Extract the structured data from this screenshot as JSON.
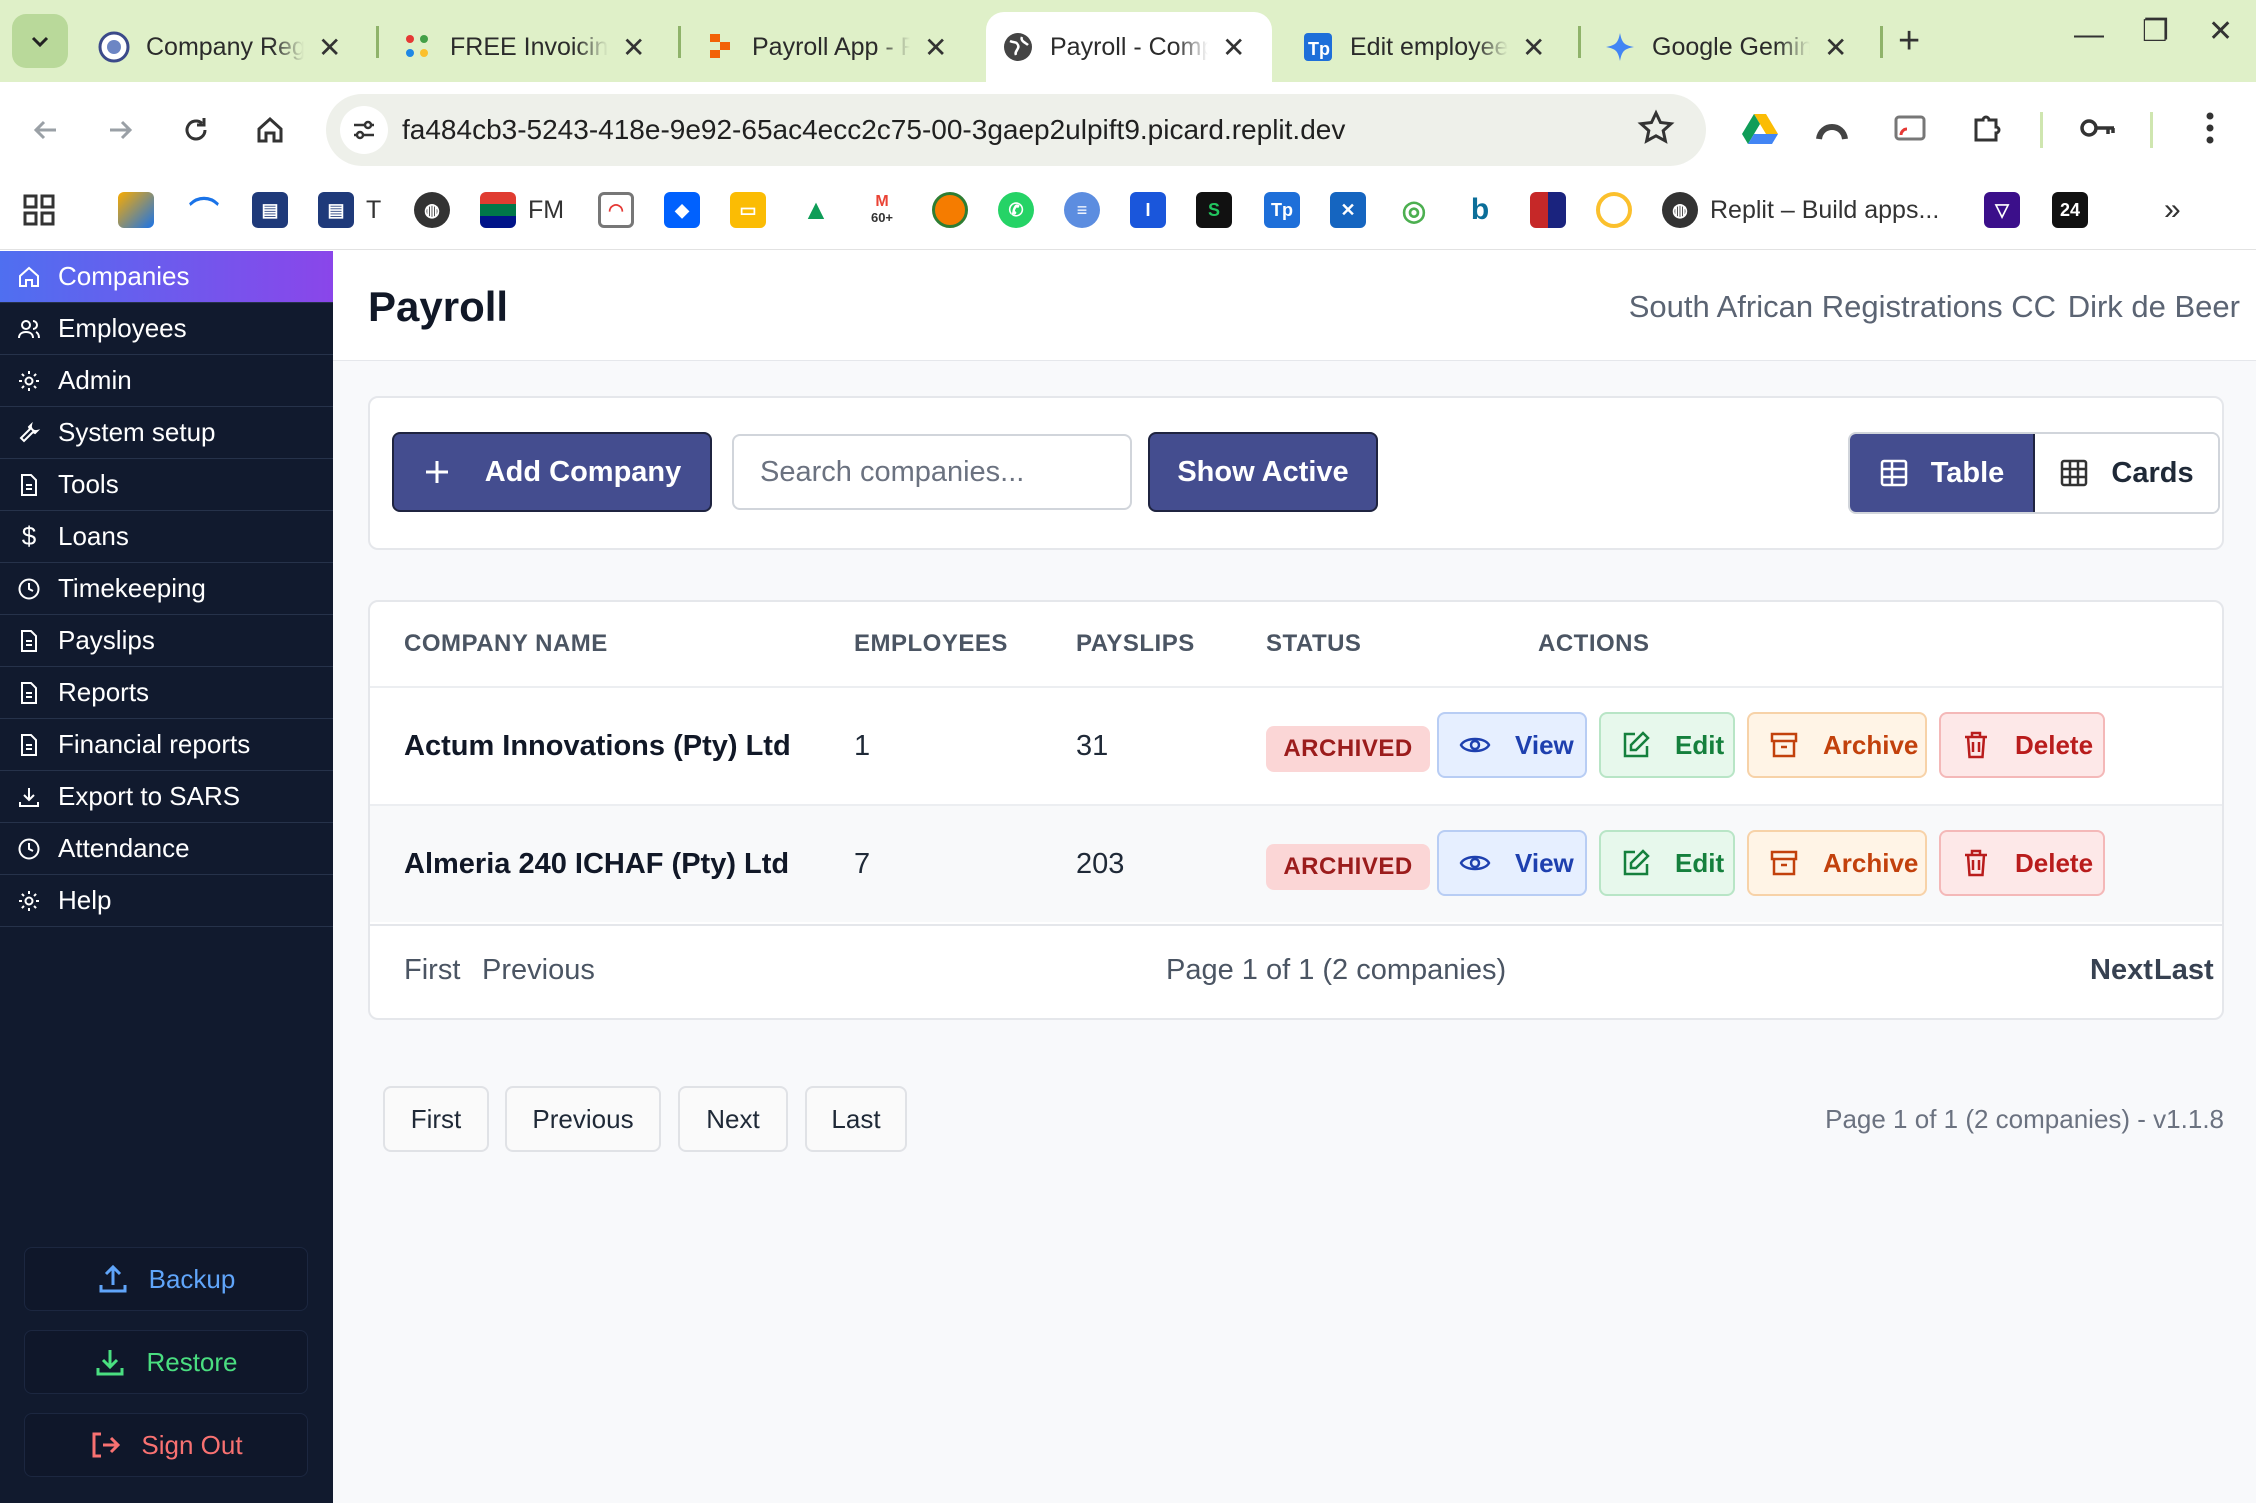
{
  "browser": {
    "tabs": [
      {
        "title": "Company Registrations",
        "icon": "globe-seal-icon"
      },
      {
        "title": "FREE Invoicing",
        "icon": "invoice-dots-icon"
      },
      {
        "title": "Payroll App - Replit",
        "icon": "replit-icon"
      },
      {
        "title": "Payroll - Companies",
        "icon": "globe-icon",
        "active": true
      },
      {
        "title": "Edit employee",
        "icon": "tp-icon"
      },
      {
        "title": "Google Gemini",
        "icon": "gemini-icon"
      }
    ],
    "url": "fa484cb3-5243-418e-9e92-65ac4ecc2c75-00-3gaep2ulpift9.picard.replit.dev",
    "bookmarks": [
      {
        "label": "T",
        "icon": "doc-icon"
      },
      {
        "label": "FM",
        "icon": "flag-icon"
      },
      {
        "label": "60+",
        "icon": "gmail-icon"
      },
      {
        "label": "Replit – Build apps...",
        "icon": "globe-icon"
      },
      {
        "label": "24",
        "icon": "calendar-icon"
      }
    ]
  },
  "sidebar": {
    "items": [
      {
        "label": "Companies",
        "icon": "home-icon",
        "active": true
      },
      {
        "label": "Employees",
        "icon": "users-icon"
      },
      {
        "label": "Admin",
        "icon": "gear-icon"
      },
      {
        "label": "System setup",
        "icon": "wrench-icon"
      },
      {
        "label": "Tools",
        "icon": "document-icon"
      },
      {
        "label": "Loans",
        "icon": "dollar-icon"
      },
      {
        "label": "Timekeeping",
        "icon": "clock-icon"
      },
      {
        "label": "Payslips",
        "icon": "document-icon"
      },
      {
        "label": "Reports",
        "icon": "document-icon"
      },
      {
        "label": "Financial reports",
        "icon": "document-icon"
      },
      {
        "label": "Export to SARS",
        "icon": "download-icon"
      },
      {
        "label": "Attendance",
        "icon": "clock-icon"
      },
      {
        "label": "Help",
        "icon": "gear-icon"
      }
    ],
    "backup": "Backup",
    "restore": "Restore",
    "signout": "Sign Out"
  },
  "header": {
    "title": "Payroll",
    "company": "South African Registrations CC",
    "user": "Dirk de Beer"
  },
  "controls": {
    "add_company": "Add Company",
    "search_placeholder": "Search companies...",
    "show_active": "Show Active",
    "view_table": "Table",
    "view_cards": "Cards"
  },
  "table": {
    "headers": [
      "COMPANY NAME",
      "EMPLOYEES",
      "PAYSLIPS",
      "STATUS",
      "ACTIONS"
    ],
    "rows": [
      {
        "name": "Actum Innovations (Pty) Ltd",
        "employees": "1",
        "payslips": "31",
        "status": "ARCHIVED"
      },
      {
        "name": "Almeria 240 ICHAF (Pty) Ltd",
        "employees": "7",
        "payslips": "203",
        "status": "ARCHIVED"
      }
    ],
    "actions": {
      "view": "View",
      "edit": "Edit",
      "archive": "Archive",
      "delete": "Delete"
    }
  },
  "pagination": {
    "first": "First",
    "previous": "Previous",
    "next": "Next",
    "last": "Last",
    "info": "Page 1 of 1 (2 companies)",
    "footer_info": "Page 1 of 1 (2 companies) - v1.1.8"
  },
  "colors": {
    "accent": "#444d8f",
    "sidebar_bg": "#111a2e",
    "active_gradient_start": "#4f6ff0",
    "active_gradient_end": "#8a46ea",
    "archived_badge": "#fbd6d6",
    "chrome_green": "#dff0c8"
  }
}
